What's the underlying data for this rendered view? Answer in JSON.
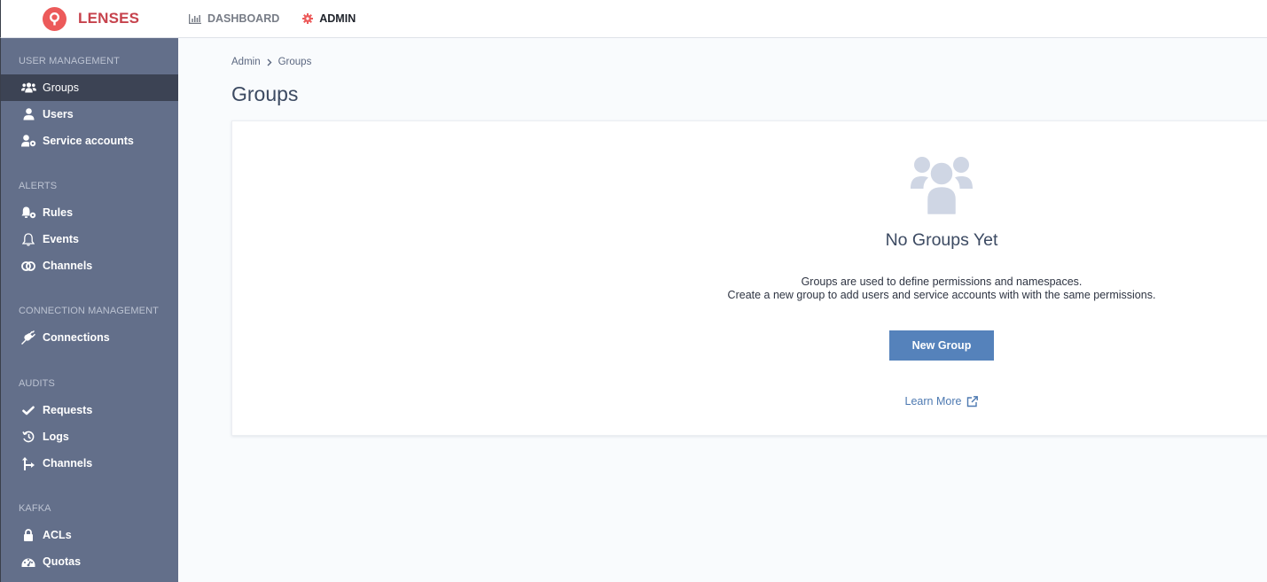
{
  "app": {
    "brand_name": "LENSES",
    "brand_color": "#ec5a5a"
  },
  "topnav": {
    "items": [
      {
        "label": "DASHBOARD",
        "icon": "bar-chart-icon",
        "active": false
      },
      {
        "label": "ADMIN",
        "icon": "gear-icon",
        "active": true
      }
    ]
  },
  "sidebar": {
    "sections": [
      {
        "title": "USER MANAGEMENT",
        "items": [
          {
            "label": "Groups",
            "icon": "users-icon",
            "active": true
          },
          {
            "label": "Users",
            "icon": "user-icon",
            "active": false
          },
          {
            "label": "Service accounts",
            "icon": "user-cog-icon",
            "active": false
          }
        ]
      },
      {
        "title": "ALERTS",
        "items": [
          {
            "label": "Rules",
            "icon": "bell-cog-icon",
            "active": false
          },
          {
            "label": "Events",
            "icon": "bell-icon",
            "active": false
          },
          {
            "label": "Channels",
            "icon": "link-rings-icon",
            "active": false
          }
        ]
      },
      {
        "title": "CONNECTION MANAGEMENT",
        "items": [
          {
            "label": "Connections",
            "icon": "plug-icon",
            "active": false
          }
        ]
      },
      {
        "title": "AUDITS",
        "items": [
          {
            "label": "Requests",
            "icon": "check-icon",
            "active": false
          },
          {
            "label": "Logs",
            "icon": "history-icon",
            "active": false
          },
          {
            "label": "Channels",
            "icon": "split-arrow-icon",
            "active": false
          }
        ]
      },
      {
        "title": "KAFKA",
        "items": [
          {
            "label": "ACLs",
            "icon": "lock-icon",
            "active": false
          },
          {
            "label": "Quotas",
            "icon": "gauge-icon",
            "active": false
          }
        ]
      }
    ]
  },
  "breadcrumb": {
    "items": [
      "Admin",
      "Groups"
    ]
  },
  "page": {
    "title": "Groups"
  },
  "empty_state": {
    "icon": "users-icon",
    "title": "No Groups Yet",
    "description_line1": "Groups are used to define permissions and namespaces.",
    "description_line2": "Create a new group to add users and service accounts with with the same permissions.",
    "button_label": "New Group",
    "link_label": "Learn More",
    "link_icon": "external-link-icon",
    "button_color": "#5582bb"
  }
}
